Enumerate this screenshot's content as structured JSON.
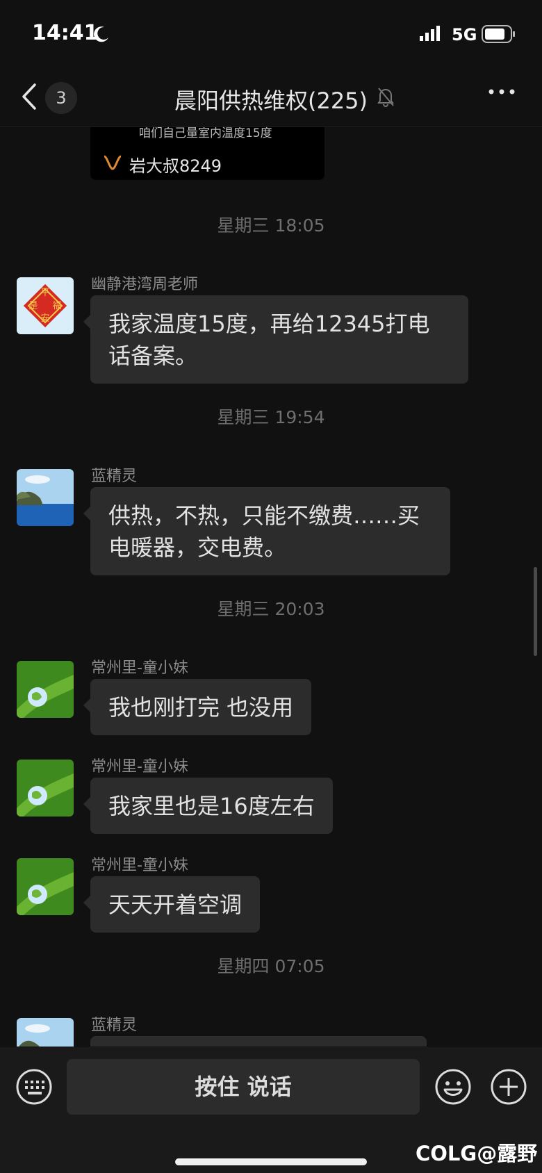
{
  "status_bar": {
    "time": "14:41",
    "network": "5G"
  },
  "header": {
    "unread_count": "3",
    "title": "晨阳供热维权(225)"
  },
  "shared_card": {
    "subtitle": "咱们自己量室内温度15度",
    "author": "岩大叔8249"
  },
  "messages": [
    {
      "timestamp": "星期三 18:05",
      "sender": "幽静港湾周老师",
      "lines": [
        "我家温度15度，再给12345打电",
        "话备案。"
      ]
    },
    {
      "timestamp": "星期三 19:54",
      "sender": "蓝精灵",
      "lines": [
        "供热，不热，只能不缴费……买",
        "电暖器，交电费。"
      ]
    },
    {
      "timestamp": "星期三 20:03",
      "sender": "常州里-童小妹",
      "lines": [
        "我也刚打完 也没用"
      ]
    },
    {
      "sender": "常州里-童小妹",
      "lines": [
        "我家里也是16度左右"
      ]
    },
    {
      "sender": "常州里-童小妹",
      "lines": [
        "天天开着空调"
      ]
    },
    {
      "timestamp": "星期四 07:05",
      "sender": "蓝精灵",
      "lines": []
    }
  ],
  "input_bar": {
    "voice_label": "按住 说话"
  },
  "watermark": "COLG@露野",
  "avatar_text": {
    "top": "平",
    "left": "是",
    "right": "福",
    "bottom": "安"
  },
  "colors": {
    "background": "#111111",
    "bubble": "#2c2c2c",
    "input_bar": "#1a1a1a",
    "card_logo": "#e0892f"
  }
}
